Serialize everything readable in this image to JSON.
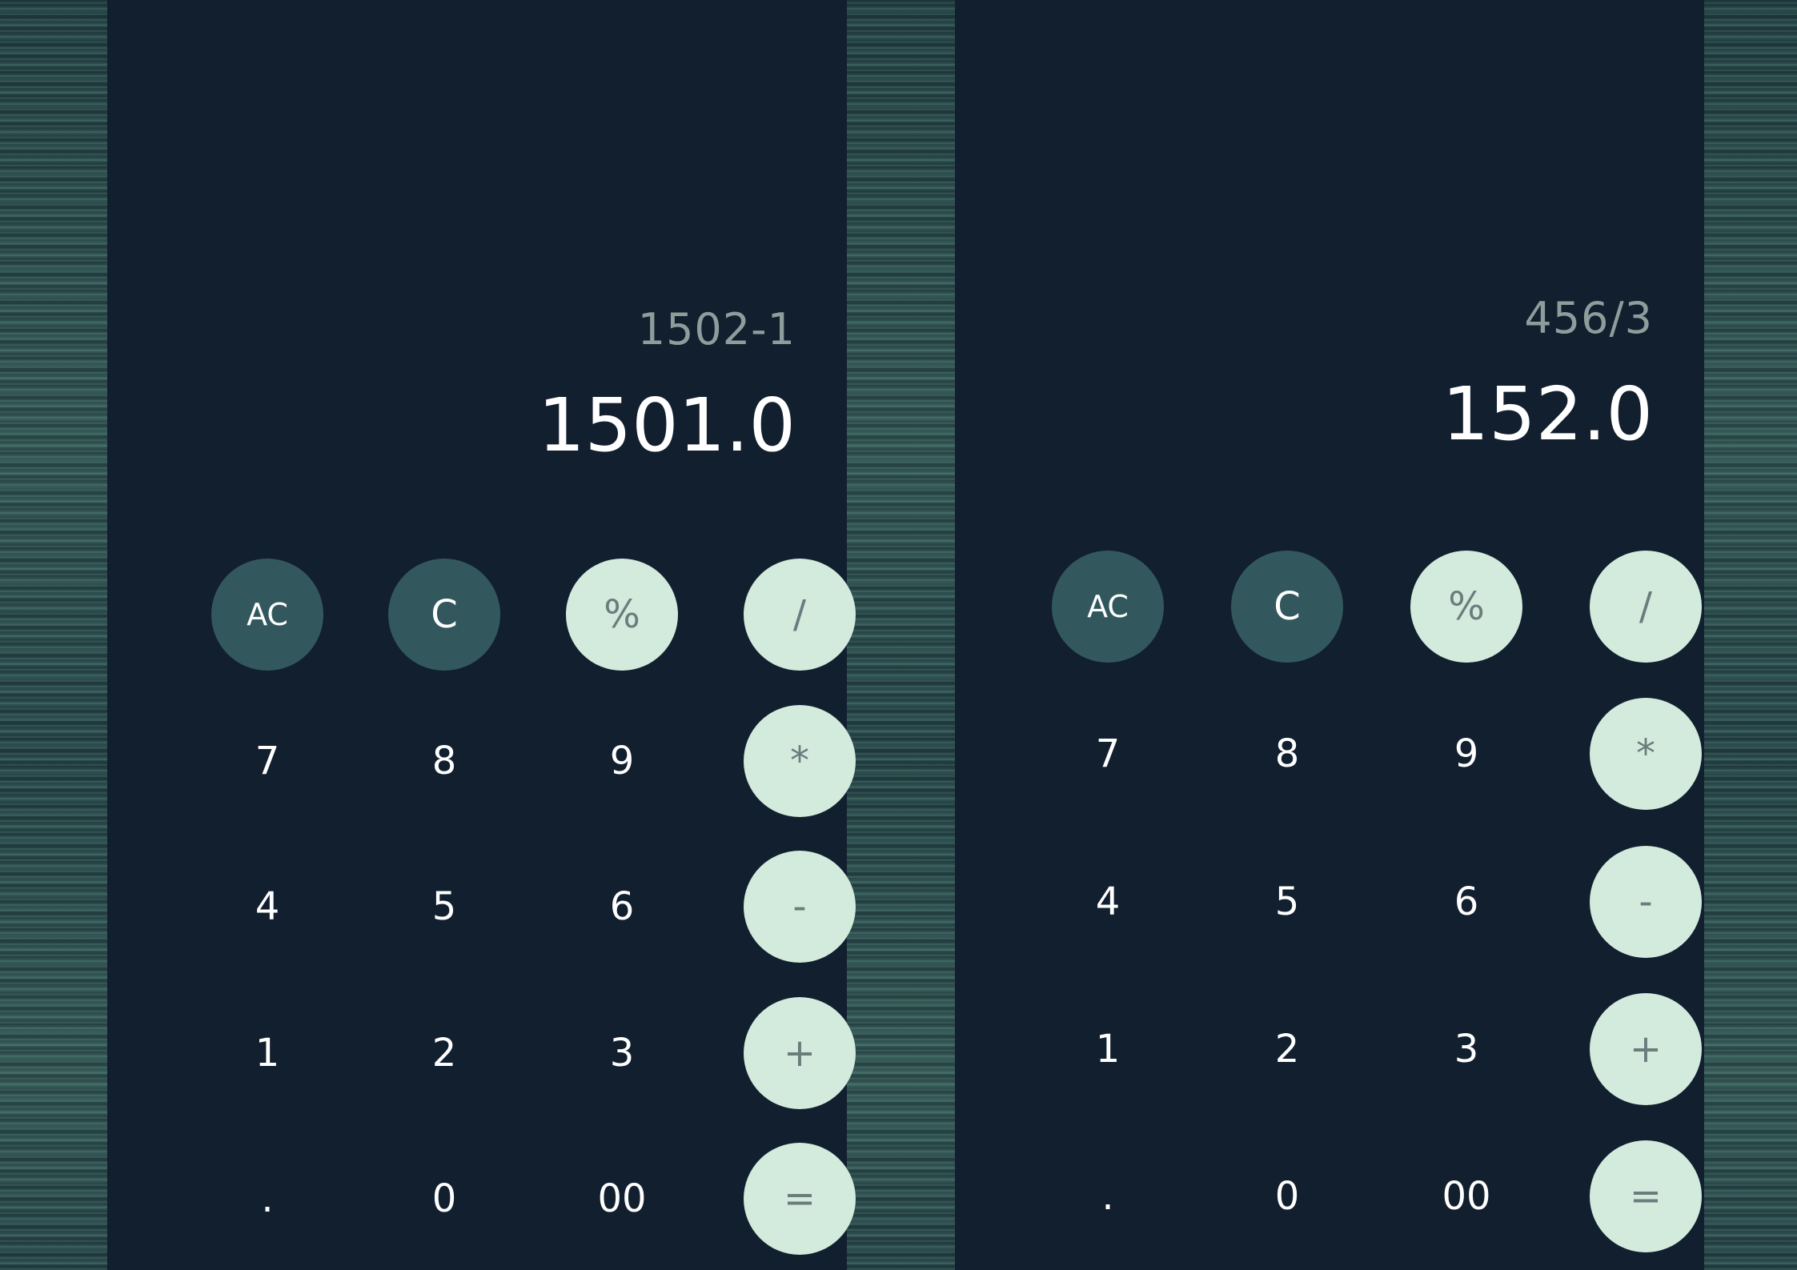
{
  "calculators": [
    {
      "expression": "1502-1",
      "result": "1501.0",
      "keys": [
        "AC",
        "C",
        "%",
        "/",
        "7",
        "8",
        "9",
        "*",
        "4",
        "5",
        "6",
        "-",
        "1",
        "2",
        "3",
        "+",
        ".",
        "0",
        "00",
        "="
      ]
    },
    {
      "expression": "456/3",
      "result": "152.0",
      "keys": [
        "AC",
        "C",
        "%",
        "/",
        "7",
        "8",
        "9",
        "*",
        "4",
        "5",
        "6",
        "-",
        "1",
        "2",
        "3",
        "+",
        ".",
        "0",
        "00",
        "="
      ]
    }
  ],
  "colors": {
    "panel_bg": "#121f2f",
    "dark_key": "#32585e",
    "light_key": "#d3ebdd",
    "light_key_text": "#6a7d7d",
    "expression_text": "#8f9c9c",
    "result_text": "#ffffff"
  }
}
